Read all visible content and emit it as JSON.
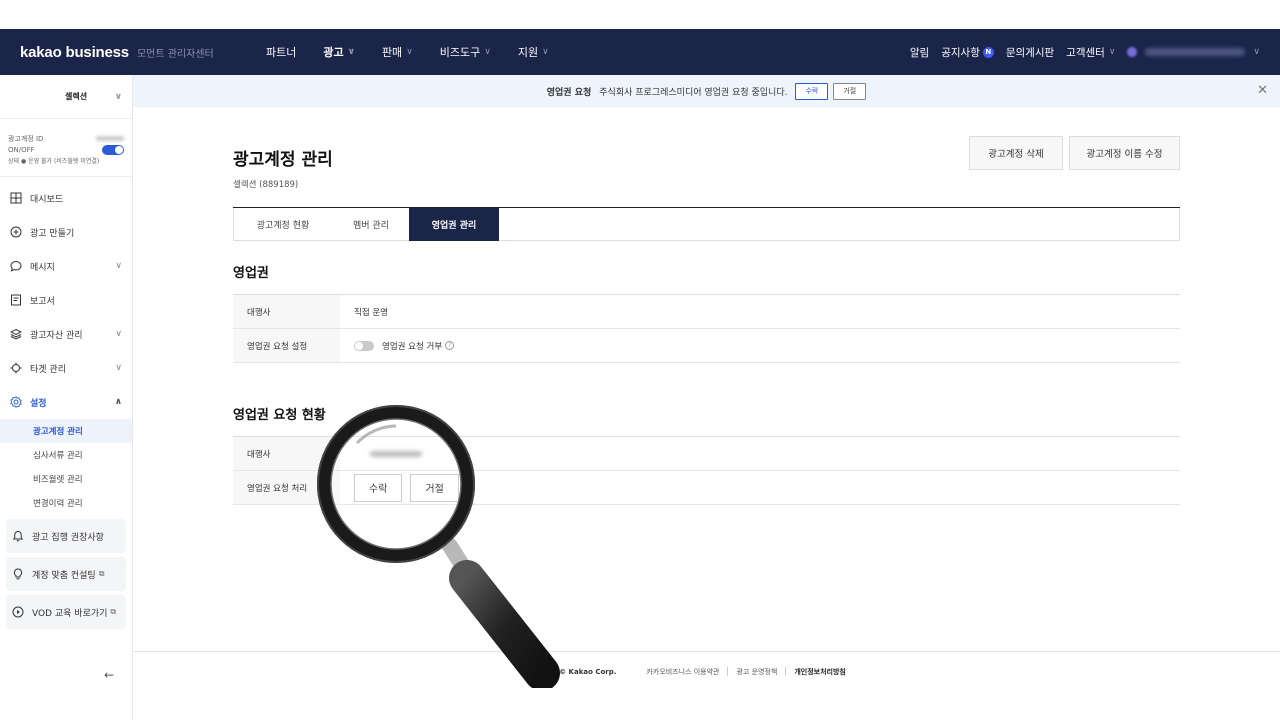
{
  "topnav": {
    "brand": "kakao business",
    "brand_sub": "모먼트 관리자센터",
    "menu": [
      {
        "label": "파트너",
        "dropdown": false
      },
      {
        "label": "광고",
        "dropdown": true
      },
      {
        "label": "판매",
        "dropdown": true
      },
      {
        "label": "비즈도구",
        "dropdown": true
      },
      {
        "label": "지원",
        "dropdown": true
      }
    ],
    "right": {
      "alarm": "알림",
      "notice": "공지사항",
      "notice_badge": "N",
      "board": "문의게시판",
      "support": "고객센터"
    }
  },
  "sidebar": {
    "account_select": "셀렉션",
    "account_id_label": "광고계정 ID",
    "onoff_label": "ON/OFF",
    "status_text": "상태 ● 운영 불가 (비즈월렛 미연결)",
    "menu": [
      {
        "label": "대시보드",
        "icon": "dashboard-icon"
      },
      {
        "label": "광고 만들기",
        "icon": "plus-circle-icon"
      },
      {
        "label": "메시지",
        "icon": "message-icon"
      },
      {
        "label": "보고서",
        "icon": "report-icon"
      },
      {
        "label": "광고자산 관리",
        "icon": "layers-icon"
      },
      {
        "label": "타겟 관리",
        "icon": "target-icon"
      },
      {
        "label": "설정",
        "icon": "gear-icon"
      }
    ],
    "submenu": [
      "광고계정 관리",
      "심사서류 관리",
      "비즈월렛 관리",
      "변경이력 관리"
    ],
    "cards": [
      {
        "label": "광고 집행 권장사항",
        "icon": "bell-icon"
      },
      {
        "label": "계정 맞춤 컨설팅",
        "icon": "bulb-icon"
      },
      {
        "label": "VOD 교육 바로가기",
        "icon": "play-icon"
      }
    ],
    "collapse": "←"
  },
  "banner": {
    "title": "영업권 요청",
    "message": "주식회사 프로그레스미디어 영업권 요청 중입니다.",
    "accept": "수락",
    "reject": "거절",
    "close": "✕"
  },
  "main": {
    "title": "광고계정 관리",
    "subtitle": "셀렉션 (889189)",
    "delete_btn": "광고계정 삭제",
    "rename_btn": "광고계정 이름 수정",
    "tabs": [
      "광고계정 현황",
      "멤버 관리",
      "영업권 관리"
    ],
    "section1": {
      "title": "영업권",
      "rows": [
        {
          "label": "대행사",
          "value": "직접 운영"
        },
        {
          "label": "영업권 요청 설정",
          "value": "영업권 요청 거부"
        }
      ]
    },
    "section2": {
      "title": "영업권 요청 현황",
      "rows": [
        {
          "label": "대행사"
        },
        {
          "label": "영업권 요청 처리"
        }
      ],
      "accept": "수락",
      "reject": "거절"
    }
  },
  "footer": {
    "corp": "© Kakao Corp.",
    "links": [
      "카카오비즈니스 이용약관",
      "광고 운영정책",
      "개인정보처리방침"
    ]
  },
  "colors": {
    "nav_bg": "#1b2449",
    "accent": "#2d5bd7",
    "banner_bg": "#eef4fc"
  }
}
